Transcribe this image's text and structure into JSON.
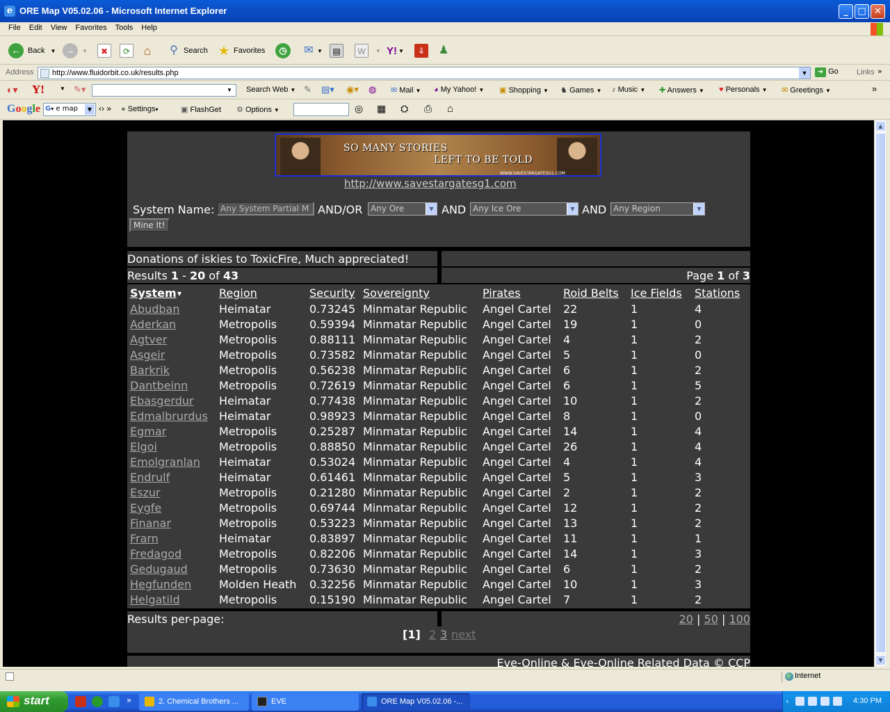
{
  "window": {
    "title": "ORE Map V05.02.06 - Microsoft Internet Explorer"
  },
  "menu": [
    "File",
    "Edit",
    "View",
    "Favorites",
    "Tools",
    "Help"
  ],
  "toolbar": {
    "back": "Back",
    "search": "Search",
    "favorites": "Favorites"
  },
  "address": {
    "label": "Address",
    "url": "http://www.fluidorbit.co.uk/results.php",
    "go": "Go",
    "links": "Links"
  },
  "yahoo_toolbar": {
    "search_web": "Search Web",
    "items": [
      "Mail",
      "My Yahoo!",
      "Shopping",
      "Games",
      "Music",
      "Answers",
      "Personals",
      "Greetings"
    ]
  },
  "google_toolbar": {
    "logo": "Google",
    "select": "e map",
    "settings": "Settings",
    "flashget": "FlashGet",
    "options": "Options"
  },
  "page": {
    "banner": {
      "line1": "SO MANY STORIES",
      "line2": "LEFT TO BE TOLD",
      "url": "WWW.SAVESTARGATESG1.COM"
    },
    "banner_link": "http://www.savestargatesg1.com",
    "form": {
      "system_label": "System Name:",
      "system_value": "Any System Partial M",
      "andor": "AND/OR",
      "ore_select": "Any Ore",
      "and1": "AND",
      "ice_select": "Any Ice Ore",
      "and2": "AND",
      "region_select": "Any Region",
      "submit": "Mine It!"
    },
    "donations": "Donations of iskies to ToxicFire, Much appreciated!",
    "results_prefix": "Results ",
    "results_from": "1",
    "results_dash": " - ",
    "results_to": "20",
    "results_of": " of ",
    "results_total": "43",
    "page_prefix": "Page ",
    "page_current": "1",
    "page_of": " of ",
    "page_total": "3",
    "columns": [
      "System",
      "Region",
      "Security",
      "Sovereignty",
      "Pirates",
      "Roid Belts",
      "Ice Fields",
      "Stations"
    ],
    "sort_indicator": "▾",
    "rows": [
      [
        "Abudban",
        "Heimatar",
        "0.73245",
        "Minmatar Republic",
        "Angel Cartel",
        "22",
        "1",
        "4"
      ],
      [
        "Aderkan",
        "Metropolis",
        "0.59394",
        "Minmatar Republic",
        "Angel Cartel",
        "19",
        "1",
        "0"
      ],
      [
        "Agtver",
        "Metropolis",
        "0.88111",
        "Minmatar Republic",
        "Angel Cartel",
        "4",
        "1",
        "2"
      ],
      [
        "Asgeir",
        "Metropolis",
        "0.73582",
        "Minmatar Republic",
        "Angel Cartel",
        "5",
        "1",
        "0"
      ],
      [
        "Barkrik",
        "Metropolis",
        "0.56238",
        "Minmatar Republic",
        "Angel Cartel",
        "6",
        "1",
        "2"
      ],
      [
        "Dantbeinn",
        "Metropolis",
        "0.72619",
        "Minmatar Republic",
        "Angel Cartel",
        "6",
        "1",
        "5"
      ],
      [
        "Ebasgerdur",
        "Heimatar",
        "0.77438",
        "Minmatar Republic",
        "Angel Cartel",
        "10",
        "1",
        "2"
      ],
      [
        "Edmalbrurdus",
        "Heimatar",
        "0.98923",
        "Minmatar Republic",
        "Angel Cartel",
        "8",
        "1",
        "0"
      ],
      [
        "Egmar",
        "Metropolis",
        "0.25287",
        "Minmatar Republic",
        "Angel Cartel",
        "14",
        "1",
        "4"
      ],
      [
        "Elgoi",
        "Metropolis",
        "0.88850",
        "Minmatar Republic",
        "Angel Cartel",
        "26",
        "1",
        "4"
      ],
      [
        "Emolgranlan",
        "Heimatar",
        "0.53024",
        "Minmatar Republic",
        "Angel Cartel",
        "4",
        "1",
        "4"
      ],
      [
        "Endrulf",
        "Heimatar",
        "0.61461",
        "Minmatar Republic",
        "Angel Cartel",
        "5",
        "1",
        "3"
      ],
      [
        "Eszur",
        "Metropolis",
        "0.21280",
        "Minmatar Republic",
        "Angel Cartel",
        "2",
        "1",
        "2"
      ],
      [
        "Eygfe",
        "Metropolis",
        "0.69744",
        "Minmatar Republic",
        "Angel Cartel",
        "12",
        "1",
        "2"
      ],
      [
        "Finanar",
        "Metropolis",
        "0.53223",
        "Minmatar Republic",
        "Angel Cartel",
        "13",
        "1",
        "2"
      ],
      [
        "Frarn",
        "Heimatar",
        "0.83897",
        "Minmatar Republic",
        "Angel Cartel",
        "11",
        "1",
        "1"
      ],
      [
        "Fredagod",
        "Metropolis",
        "0.82206",
        "Minmatar Republic",
        "Angel Cartel",
        "14",
        "1",
        "3"
      ],
      [
        "Gedugaud",
        "Metropolis",
        "0.73630",
        "Minmatar Republic",
        "Angel Cartel",
        "6",
        "1",
        "2"
      ],
      [
        "Hegfunden",
        "Molden Heath",
        "0.32256",
        "Minmatar Republic",
        "Angel Cartel",
        "10",
        "1",
        "3"
      ],
      [
        "Helgatild",
        "Metropolis",
        "0.15190",
        "Minmatar Republic",
        "Angel Cartel",
        "7",
        "1",
        "2"
      ]
    ],
    "per_page_label": "Results per-page:",
    "per_page_options": [
      "20",
      "50",
      "100"
    ],
    "per_page_sep": "|",
    "pages": {
      "current": "[1]",
      "p2": "2",
      "p3": "3",
      "next": "next"
    },
    "footer": "Eve-Online & Eve-Online Related Data © CCP"
  },
  "statusbar": {
    "zone": "Internet"
  },
  "taskbar": {
    "start": "start",
    "tasks": [
      "2. Chemical Brothers ...",
      "EVE",
      "ORE Map V05.02.06 -..."
    ],
    "clock": "4:30 PM"
  },
  "colors": {
    "page_bg": "#000000",
    "panel_bg": "#3a3a3a",
    "link": "#aaaaaa",
    "banner_border": "#1b2fd6"
  }
}
